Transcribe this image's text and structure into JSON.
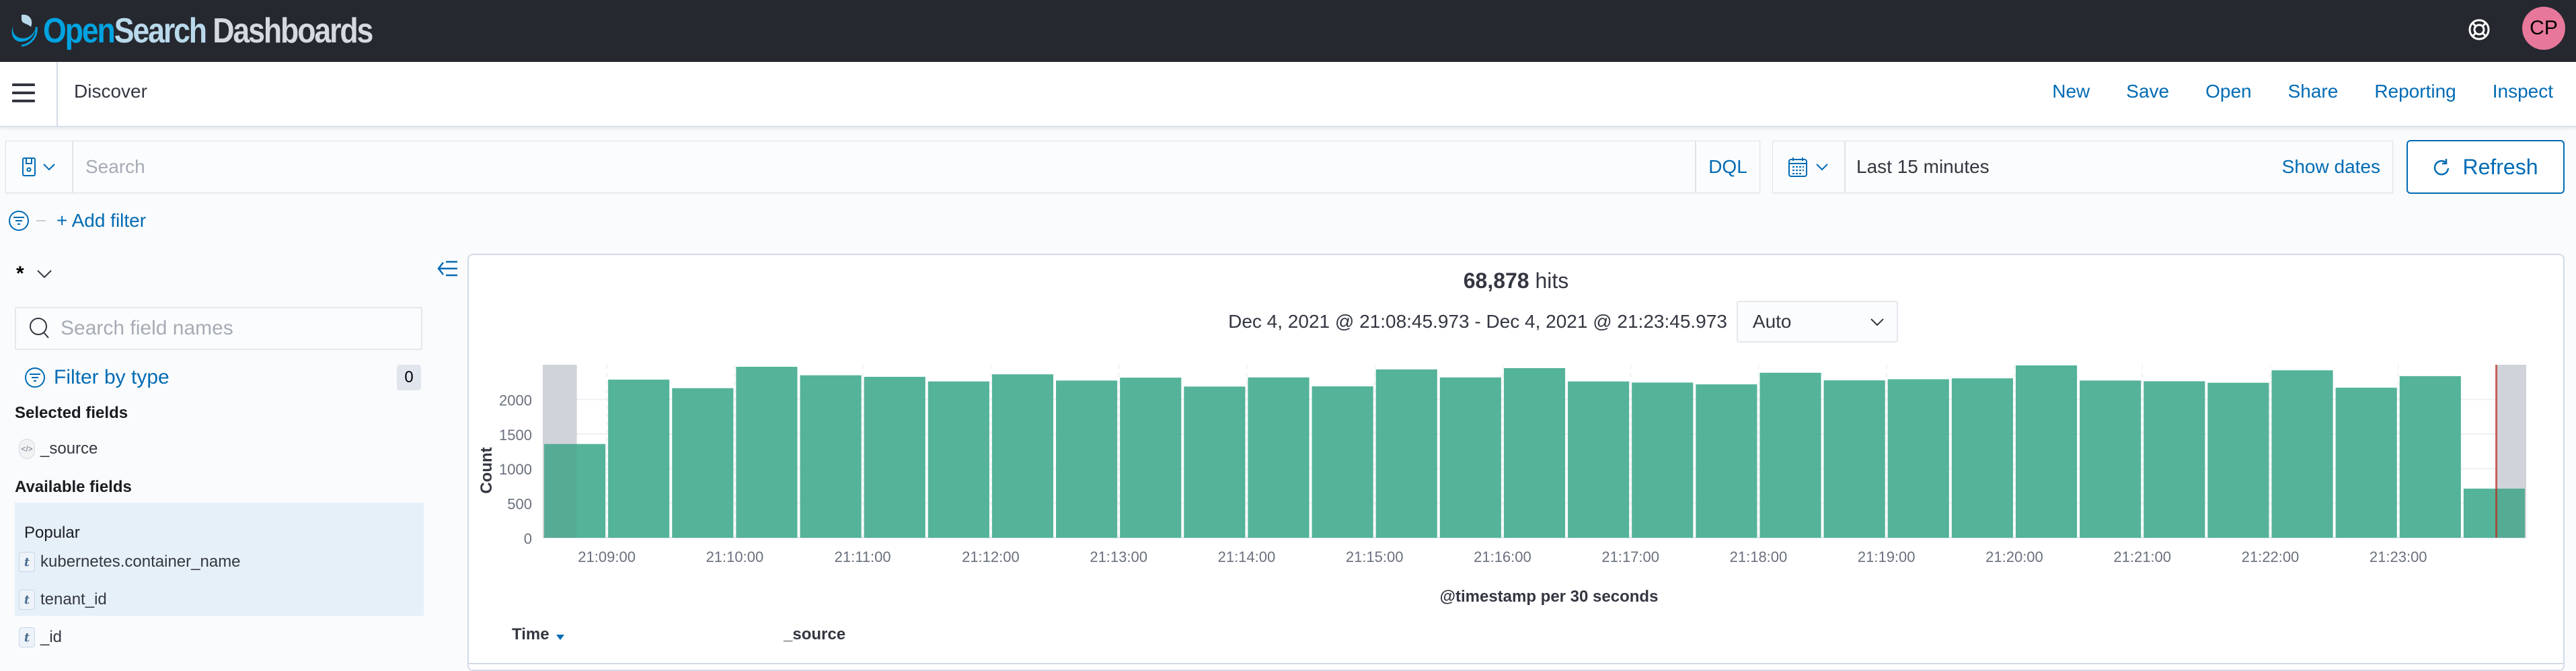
{
  "header": {
    "logo": {
      "part1": "Open",
      "part2": "Search",
      "part3": "Dashboards"
    },
    "help_icon": "lifebuoy-icon",
    "avatar_initials": "CP",
    "avatar_color": "#e7789b"
  },
  "appbar": {
    "menu_icon": "hamburger-icon",
    "breadcrumb": "Discover",
    "nav": [
      "New",
      "Save",
      "Open",
      "Share",
      "Reporting",
      "Inspect"
    ]
  },
  "querybar": {
    "saved_query_icon": "save-icon",
    "search_placeholder": "Search",
    "search_value": "",
    "language": "DQL",
    "date_icon": "calendar-icon",
    "date_label": "Last 15 minutes",
    "show_dates": "Show dates",
    "refresh": "Refresh"
  },
  "filterbar": {
    "add_filter": "+ Add filter"
  },
  "sidebar": {
    "index_pattern": "*",
    "field_search_placeholder": "Search field names",
    "filter_by_type": "Filter by type",
    "filter_count": "0",
    "selected_title": "Selected fields",
    "selected_fields": [
      {
        "name": "_source",
        "type": "source"
      }
    ],
    "available_title": "Available fields",
    "popular_label": "Popular",
    "popular_fields": [
      {
        "name": "kubernetes.container_name",
        "type": "t"
      },
      {
        "name": "tenant_id",
        "type": "t"
      }
    ],
    "other_fields": [
      {
        "name": "_id",
        "type": "t"
      }
    ]
  },
  "results": {
    "hits_count": "68,878",
    "hits_label": "hits",
    "time_range": "Dec 4, 2021 @ 21:08:45.973 - Dec 4, 2021 @ 21:23:45.973",
    "interval": "Auto",
    "table_columns": [
      "Time",
      "_source"
    ]
  },
  "colors": {
    "accent": "#006bb4",
    "bar": "#54b399",
    "now_line": "#bd271e",
    "out_of_range": "#dfe1e6"
  },
  "chart_data": {
    "type": "bar",
    "title": "",
    "xlabel": "@timestamp per 30 seconds",
    "ylabel": "Count",
    "ylim": [
      0,
      2500
    ],
    "yticks": [
      0,
      500,
      1000,
      1500,
      2000
    ],
    "x_domain": [
      "21:08:30",
      "21:24:00"
    ],
    "interval_seconds": 30,
    "xticks": [
      "21:09:00",
      "21:10:00",
      "21:11:00",
      "21:12:00",
      "21:13:00",
      "21:14:00",
      "21:15:00",
      "21:16:00",
      "21:17:00",
      "21:18:00",
      "21:19:00",
      "21:20:00",
      "21:21:00",
      "21:22:00",
      "21:23:00"
    ],
    "categories": [
      "21:08:30",
      "21:09:00",
      "21:09:30",
      "21:10:00",
      "21:10:30",
      "21:11:00",
      "21:11:30",
      "21:12:00",
      "21:12:30",
      "21:13:00",
      "21:13:30",
      "21:14:00",
      "21:14:30",
      "21:15:00",
      "21:15:30",
      "21:16:00",
      "21:16:30",
      "21:17:00",
      "21:17:30",
      "21:18:00",
      "21:18:30",
      "21:19:00",
      "21:19:30",
      "21:20:00",
      "21:20:30",
      "21:21:00",
      "21:21:30",
      "21:22:00",
      "21:22:30",
      "21:23:00",
      "21:23:30"
    ],
    "values": [
      1355,
      2285,
      2162,
      2471,
      2348,
      2326,
      2259,
      2362,
      2272,
      2314,
      2185,
      2317,
      2188,
      2433,
      2317,
      2452,
      2259,
      2243,
      2217,
      2385,
      2275,
      2291,
      2304,
      2491,
      2272,
      2262,
      2240,
      2420,
      2169,
      2336,
      710
    ],
    "range_start": "21:08:45.973",
    "range_end": "21:23:45.973",
    "now_marker": "21:23:45.973",
    "grid": true,
    "legend": "none"
  }
}
